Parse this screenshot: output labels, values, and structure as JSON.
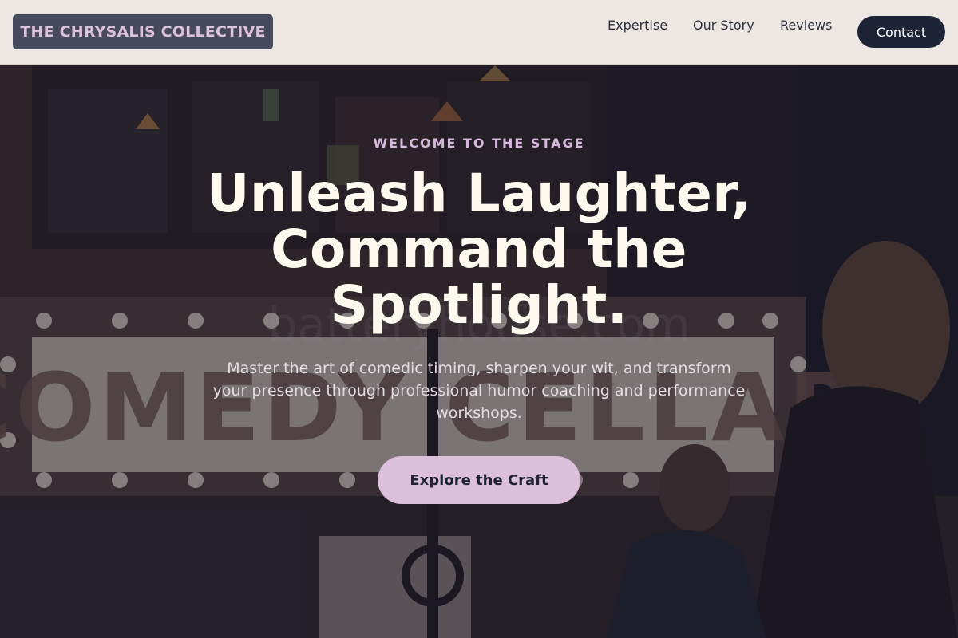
{
  "brand": {
    "name": "THE CHRYSALIS COLLECTIVE"
  },
  "nav": {
    "links": [
      "Expertise",
      "Our Story",
      "Reviews"
    ],
    "contact_label": "Contact"
  },
  "hero": {
    "eyebrow": "WELCOME TO THE STAGE",
    "headline_lines": [
      "Unleash Laughter,",
      "Command the",
      "Spotlight."
    ],
    "subtext": "Master the art of comedic timing, sharpen your wit, and transform your presence through professional humor coaching and performance workshops.",
    "cta_label": "Explore the Craft",
    "background_sign_text": "COMEDY CELLAR",
    "watermark_text": "batteryhouse.com"
  },
  "colors": {
    "header_bg": "#ece7e2",
    "logo_bg": "#464a5c",
    "logo_text": "#dcc1dc",
    "contact_bg": "#1d2436",
    "eyebrow": "#d6b8dc",
    "cta_bg": "#dcc0db",
    "headline": "#fdf9ee"
  }
}
